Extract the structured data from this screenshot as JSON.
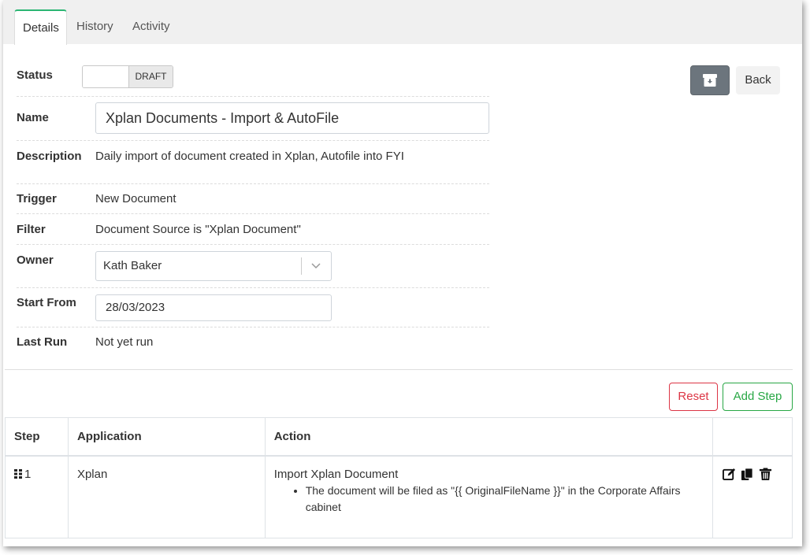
{
  "tabs": [
    {
      "label": "Details",
      "active": true
    },
    {
      "label": "History",
      "active": false
    },
    {
      "label": "Activity",
      "active": false
    }
  ],
  "form": {
    "status": {
      "label": "Status",
      "value": "DRAFT"
    },
    "name": {
      "label": "Name",
      "value": "Xplan Documents - Import & AutoFile"
    },
    "description": {
      "label": "Description",
      "value": "Daily import of document created in Xplan, Autofile into FYI"
    },
    "trigger": {
      "label": "Trigger",
      "value": "New Document"
    },
    "filter": {
      "label": "Filter",
      "value": "Document Source is \"Xplan Document\""
    },
    "owner": {
      "label": "Owner",
      "value": "Kath Baker"
    },
    "start_from": {
      "label": "Start From",
      "value": "28/03/2023"
    },
    "last_run": {
      "label": "Last Run",
      "value": "Not yet run"
    }
  },
  "header_buttons": {
    "archive_icon": "archive-icon",
    "back_label": "Back"
  },
  "step_buttons": {
    "reset_label": "Reset",
    "add_label": "Add Step"
  },
  "table": {
    "headers": {
      "step": "Step",
      "application": "Application",
      "action": "Action"
    },
    "rows": [
      {
        "step": "1",
        "application": "Xplan",
        "action": "Import Xplan Document",
        "detail": "The document will be filed as \"{{ OriginalFileName }}\" in the Corporate Affairs cabinet"
      }
    ]
  },
  "colors": {
    "accent": "#2bb673",
    "danger": "#dc3545",
    "success": "#28a745",
    "secondary": "#6c757d"
  }
}
